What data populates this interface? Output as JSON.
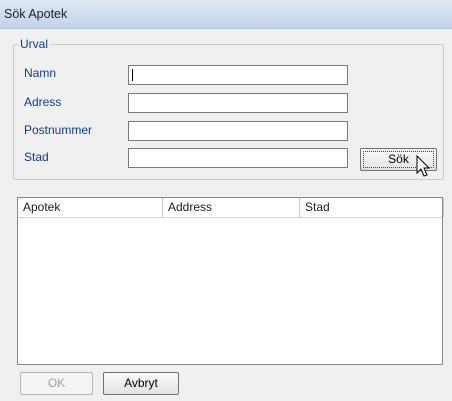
{
  "window": {
    "title": "Sök Apotek"
  },
  "filter": {
    "group_label": "Urval",
    "fields": [
      {
        "label": "Namn",
        "value": ""
      },
      {
        "label": "Adress",
        "value": ""
      },
      {
        "label": "Postnummer",
        "value": ""
      },
      {
        "label": "Stad",
        "value": ""
      }
    ],
    "search_button": "Sök"
  },
  "results": {
    "columns": [
      "Apotek",
      "Address",
      "Stad"
    ],
    "rows": []
  },
  "footer": {
    "ok_label": "OK",
    "cancel_label": "Avbryt"
  },
  "icons": {
    "cursor": "arrow-pointer-icon"
  }
}
